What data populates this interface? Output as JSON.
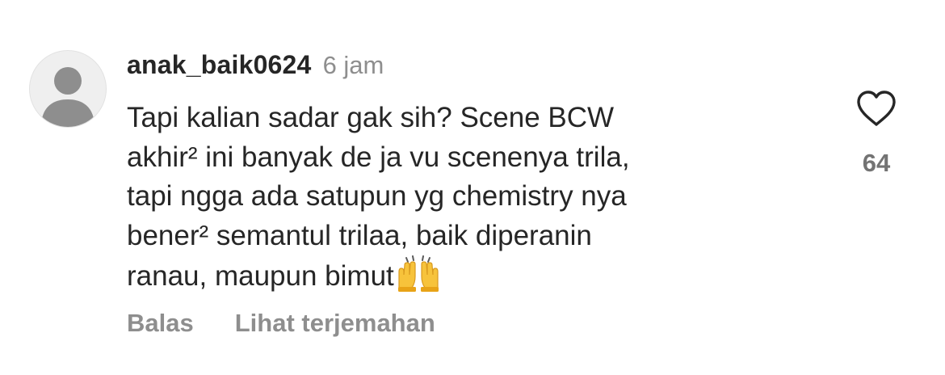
{
  "comment": {
    "username": "anak_baik0624",
    "time": "6 jam",
    "text_lines": [
      "Tapi kalian sadar gak sih? Scene BCW",
      "akhir² ini banyak de ja vu scenenya trila,",
      "tapi ngga ada satupun yg chemistry nya",
      "bener² semantul trilaa, baik diperanin",
      "ranau, maupun bimut"
    ],
    "emoji": "raising-hands",
    "like_count": "64",
    "actions": {
      "reply_label": "Balas",
      "translate_label": "Lihat terjemahan"
    }
  },
  "colors": {
    "primary_text": "#262626",
    "secondary_text": "#8e8e8e",
    "avatar_bg": "#efefef",
    "avatar_figure": "#8e8e8e",
    "icon_stroke": "#262626"
  },
  "icons": {
    "avatar": "default-avatar-icon",
    "like": "heart-outline-icon"
  }
}
